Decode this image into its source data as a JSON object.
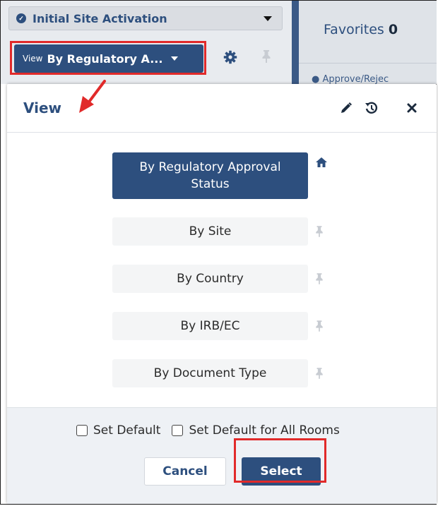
{
  "header": {
    "workflow_label": "Initial Site Activation",
    "view_prefix": "View",
    "view_value": "By Regulatory A...",
    "favorites_label": "Favorites",
    "favorites_count": "0",
    "favorites_item": "Approve/Rejec"
  },
  "modal": {
    "title": "View",
    "options": [
      {
        "label": "By Regulatory Approval Status",
        "active": true,
        "icon": "home-icon"
      },
      {
        "label": "By Site",
        "active": false,
        "icon": "pin-icon"
      },
      {
        "label": "By Country",
        "active": false,
        "icon": "pin-icon"
      },
      {
        "label": "By IRB/EC",
        "active": false,
        "icon": "pin-icon"
      },
      {
        "label": "By Document Type",
        "active": false,
        "icon": "pin-icon"
      }
    ],
    "set_default_label": "Set Default",
    "set_default_all_label": "Set Default for All Rooms",
    "cancel_label": "Cancel",
    "select_label": "Select"
  },
  "colors": {
    "primary": "#2d4f7e",
    "highlight": "#e12a2a",
    "footer_bg": "#eef1f5"
  }
}
